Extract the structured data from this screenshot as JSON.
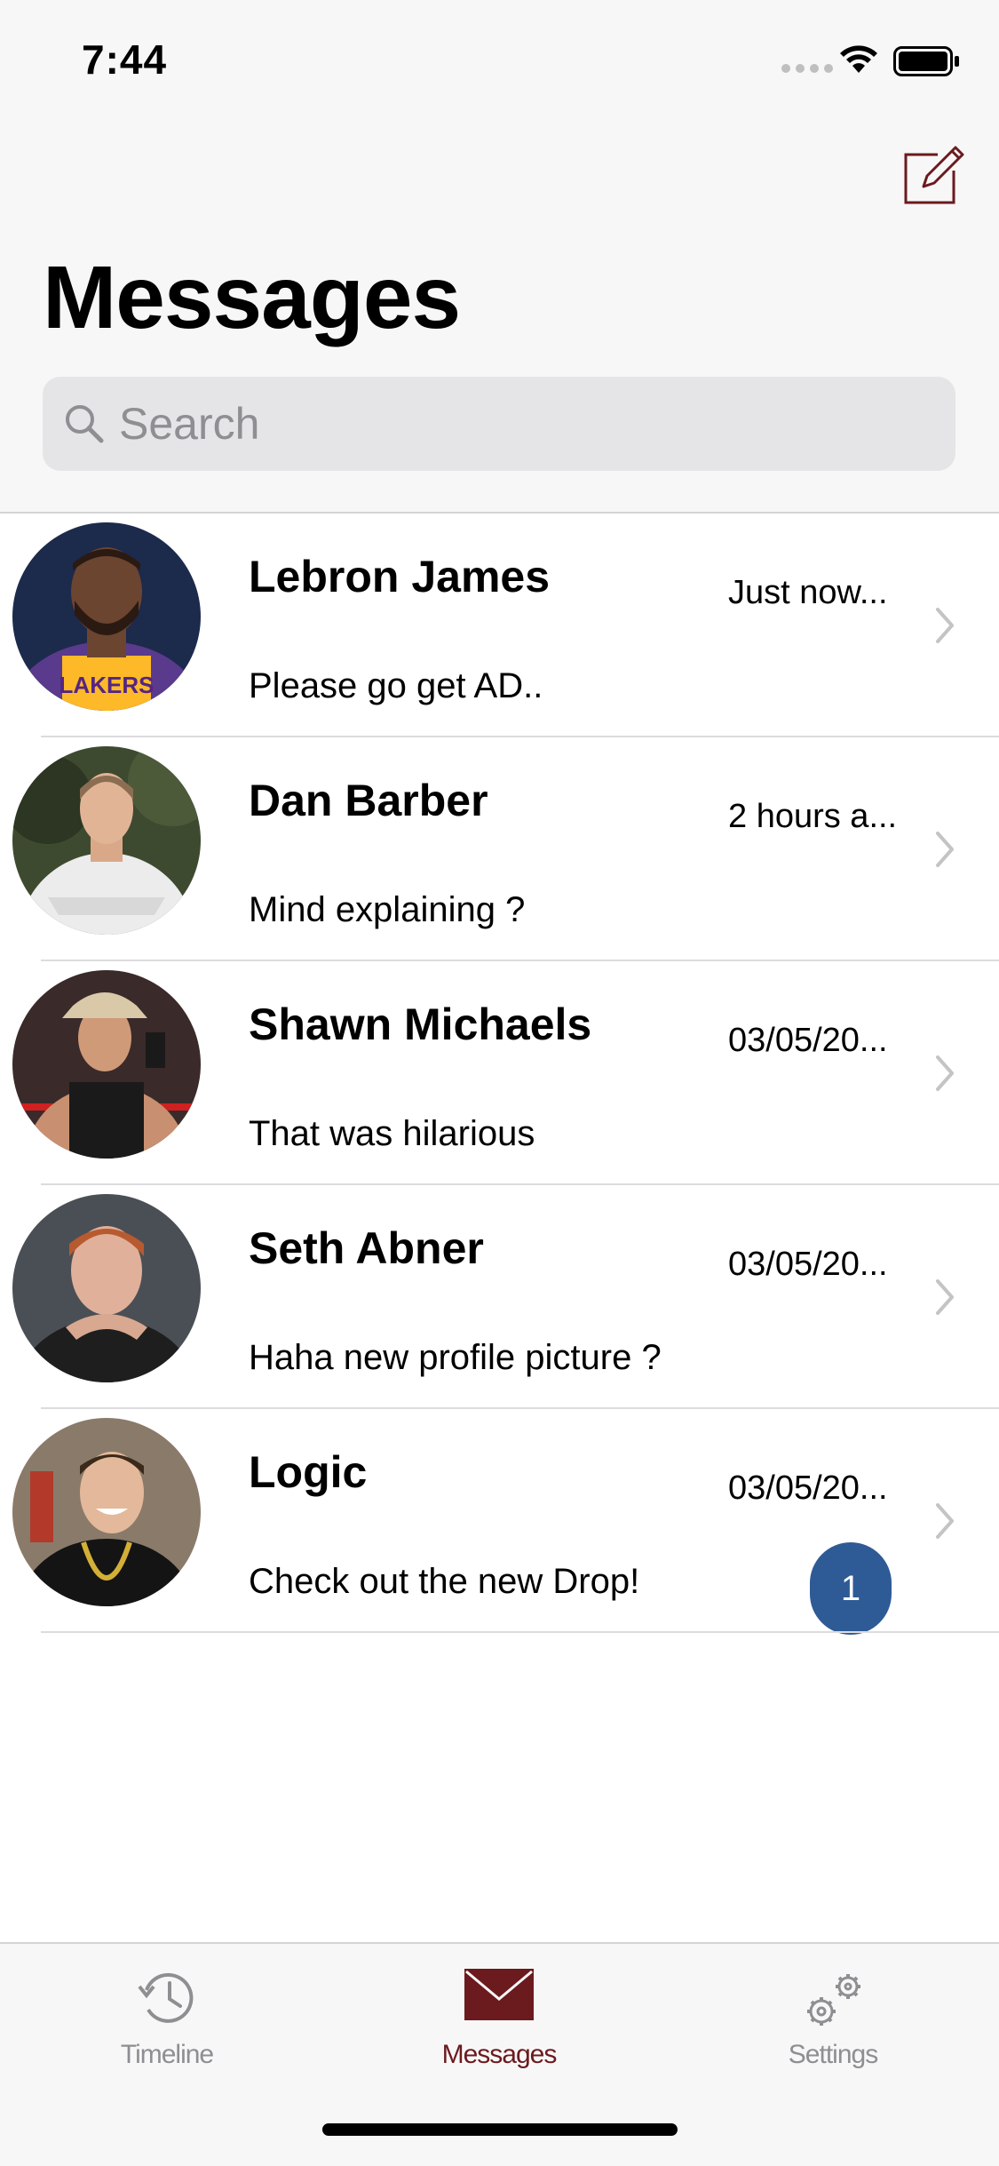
{
  "status_bar": {
    "time": "7:44"
  },
  "header": {
    "title": "Messages",
    "compose_icon": "compose-icon",
    "accent": "#6b1a1e"
  },
  "search": {
    "placeholder": "Search"
  },
  "conversations": [
    {
      "name": "Lebron James",
      "time": "Just now...",
      "preview": "Please go get AD..",
      "avatar": "avatar-lebron-james"
    },
    {
      "name": "Dan Barber",
      "time": "2 hours a...",
      "preview": "Mind explaining ?",
      "avatar": "avatar-dan-barber"
    },
    {
      "name": "Shawn Michaels",
      "time": "03/05/20...",
      "preview": "That was hilarious",
      "avatar": "avatar-shawn-michaels"
    },
    {
      "name": "Seth Abner",
      "time": "03/05/20...",
      "preview": "Haha new profile picture ?",
      "avatar": "avatar-seth-abner"
    },
    {
      "name": "Logic",
      "time": "03/05/20...",
      "preview": "Check out the new Drop!",
      "avatar": "avatar-logic",
      "unread": "1"
    }
  ],
  "tab_bar": {
    "items": [
      {
        "label": "Timeline",
        "icon": "clock-history-icon",
        "selected": false
      },
      {
        "label": "Messages",
        "icon": "envelope-icon",
        "selected": true
      },
      {
        "label": "Settings",
        "icon": "gears-icon",
        "selected": false
      }
    ],
    "selected_color": "#6b1a1e",
    "inactive_color": "#8e8e93",
    "badge_color": "#2e5b95"
  }
}
